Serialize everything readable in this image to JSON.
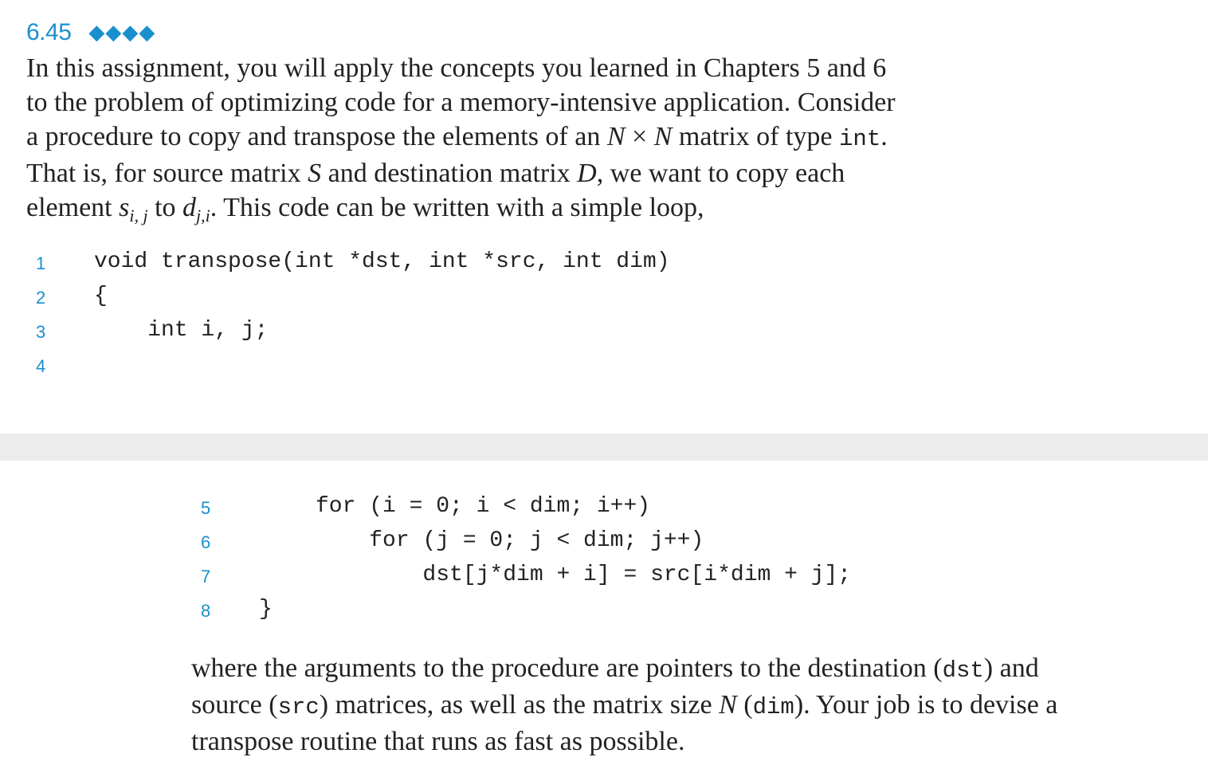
{
  "exercise": {
    "number": "6.45",
    "difficulty_marks": "◆◆◆◆",
    "difficulty_color": "#1a8fce"
  },
  "intro": {
    "l1": "In this assignment, you will apply the concepts you learned in Chapters 5 and 6",
    "l2": "to the problem of optimizing code for a memory-intensive application. Consider",
    "l3_a": "a procedure to copy and transpose the elements of an ",
    "l3_n1": "N",
    "l3_times": " × ",
    "l3_n2": "N",
    "l3_b": " matrix of type ",
    "l3_code": "int",
    "l3_c": ".",
    "l4_a": "That is, for source matrix ",
    "l4_s": "S",
    "l4_b": " and destination matrix ",
    "l4_d": "D",
    "l4_c": ", we want to copy each",
    "l5_a": "element ",
    "l5_s": "s",
    "l5_s_sub": "i, j",
    "l5_b": " to ",
    "l5_d": "d",
    "l5_d_sub": "j,i",
    "l5_c": ". This code can be written with a simple loop,"
  },
  "code": [
    {
      "num": "1",
      "text": "void transpose(int *dst, int *src, int dim)"
    },
    {
      "num": "2",
      "text": "{"
    },
    {
      "num": "3",
      "text": "    int i, j;"
    },
    {
      "num": "4",
      "text": ""
    },
    {
      "num": "5",
      "text": "for (i = 0; i < dim; i++)"
    },
    {
      "num": "6",
      "text": "    for (j = 0; j < dim; j++)"
    },
    {
      "num": "7",
      "text": "        dst[j*dim + i] = src[i*dim + j];"
    },
    {
      "num": "8",
      "text": "}"
    }
  ],
  "outro": {
    "l1_a": "where the arguments to the procedure are pointers to the destination (",
    "l1_code": "dst",
    "l1_b": ") and",
    "l2_a": "source (",
    "l2_code1": "src",
    "l2_b": ") matrices, as well as the matrix size ",
    "l2_n": "N",
    "l2_c": " (",
    "l2_code2": "dim",
    "l2_d": "). Your job is to devise a",
    "l3": "transpose routine that runs as fast as possible."
  }
}
